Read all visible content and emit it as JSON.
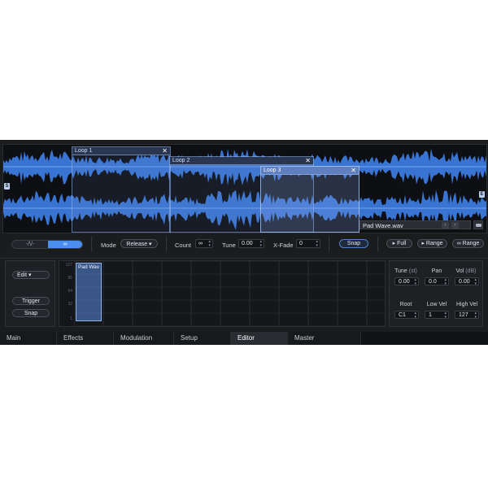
{
  "waveform": {
    "start_marker": "S",
    "end_marker": "E",
    "loops": [
      {
        "label": "Loop 1",
        "close": "✕"
      },
      {
        "label": "Loop 2",
        "close": "✕"
      },
      {
        "label": "Loop 3",
        "close": "✕"
      }
    ],
    "sample_name": "Pad Wave.wav",
    "prev_arrow": "‹",
    "next_arrow": "›"
  },
  "controls": {
    "segment_left": "-/\\/-",
    "segment_right": "∞",
    "mode_label": "Mode",
    "mode_value": "Release ▾",
    "count_label": "Count",
    "count_value": "∞",
    "tune_label": "Tune",
    "tune_value": "0.00",
    "xfade_label": "X-Fade",
    "xfade_value": "0",
    "snap_label": "Snap",
    "full_label": "▸ Full",
    "range_label": "▸ Range",
    "loop_range_label": "∞ Range"
  },
  "editor": {
    "edit_label": "Edit ▾",
    "trigger_label": "Trigger",
    "snap_label": "Snap",
    "velocity_ticks": [
      "127",
      "96",
      "64",
      "32",
      "1"
    ],
    "zone_label": "Pad Wav",
    "params": {
      "tune_label": "Tune",
      "tune_unit": "(st)",
      "tune_value": "0.00",
      "pan_label": "Pan",
      "pan_value": "0.0",
      "vol_label": "Vol",
      "vol_unit": "(dB)",
      "vol_value": "0.00",
      "root_label": "Root",
      "root_value": "C1",
      "lowvel_label": "Low Vel",
      "lowvel_value": "1",
      "highvel_label": "High Vel",
      "highvel_value": "127"
    }
  },
  "tabs": [
    {
      "label": "Main"
    },
    {
      "label": "Effects"
    },
    {
      "label": "Modulation"
    },
    {
      "label": "Setup"
    },
    {
      "label": "Editor"
    },
    {
      "label": "Master"
    }
  ],
  "active_tab": "Editor",
  "colors": {
    "accent": "#4a8ff0",
    "waveform": "#3f7fe8",
    "background": "#1b1c1e"
  }
}
